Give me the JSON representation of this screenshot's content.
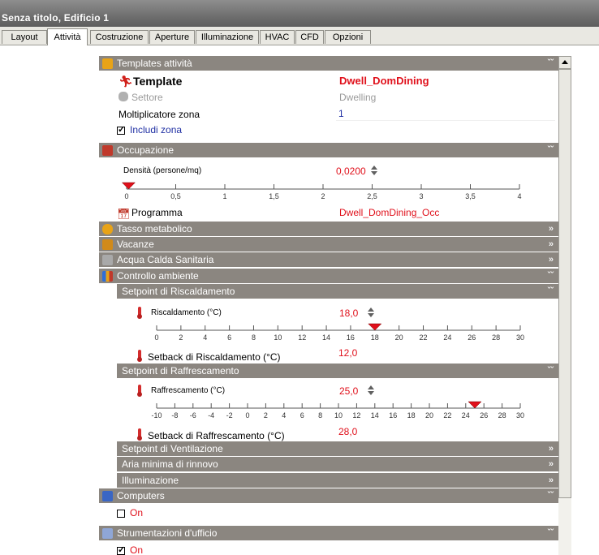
{
  "window": {
    "title": "Senza titolo, Edificio 1"
  },
  "tabs": [
    "Layout",
    "Attività",
    "Costruzione",
    "Aperture",
    "Illuminazione",
    "HVAC",
    "CFD",
    "Opzioni"
  ],
  "active_tab": "Attività",
  "templates": {
    "header": "Templates attività",
    "template_label": "Template",
    "template_value": "Dwell_DomDining",
    "settore_label": "Settore",
    "settore_value": "Dwelling",
    "moltiplicatore_label": "Moltiplicatore zona",
    "moltiplicatore_value": "1",
    "includi_label": "Includi zona",
    "includi_checked": true
  },
  "occupazione": {
    "header": "Occupazione",
    "densita_label": "Densità (persone/mq)",
    "densita_value": "0,0200",
    "scale_ticks": [
      "0",
      "0,5",
      "1",
      "1,5",
      "2",
      "2,5",
      "3",
      "3,5",
      "4"
    ],
    "slider_value": 0.02,
    "programma_label": "Programma",
    "programma_value": "Dwell_DomDining_Occ"
  },
  "collapsed_sections": {
    "tasso": "Tasso metabolico",
    "vacanze": "Vacanze",
    "acqua": "Acqua Calda Sanitaria"
  },
  "controllo": {
    "header": "Controllo ambiente",
    "riscaldamento": {
      "header": "Setpoint di Riscaldamento",
      "label": "Riscaldamento (°C)",
      "value": "18,0",
      "slider_value": 18,
      "scale_ticks": [
        "0",
        "2",
        "4",
        "6",
        "8",
        "10",
        "12",
        "14",
        "16",
        "18",
        "20",
        "22",
        "24",
        "26",
        "28",
        "30"
      ],
      "setback_label": "Setback di Riscaldamento (°C)",
      "setback_value": "12,0"
    },
    "raffrescamento": {
      "header": "Setpoint di Raffrescamento",
      "label": "Raffrescamento (°C)",
      "value": "25,0",
      "slider_value": 25,
      "scale_ticks": [
        "-10",
        "-8",
        "-6",
        "-4",
        "-2",
        "0",
        "2",
        "4",
        "6",
        "8",
        "10",
        "12",
        "14",
        "16",
        "18",
        "20",
        "22",
        "24",
        "26",
        "28",
        "30"
      ],
      "setback_label": "Setback di Raffrescamento (°C)",
      "setback_value": "28,0"
    },
    "ventilazione": "Setpoint di Ventilazione",
    "aria": "Aria minima di rinnovo",
    "illuminazione": "Illuminazione"
  },
  "computers": {
    "header": "Computers",
    "on_label": "On",
    "checked": false
  },
  "strumentazioni": {
    "header": "Strumentazioni d'ufficio",
    "on_label": "On",
    "checked": true
  },
  "colors": {
    "accent_red": "#e0101b",
    "section_bg": "#8b8680"
  }
}
